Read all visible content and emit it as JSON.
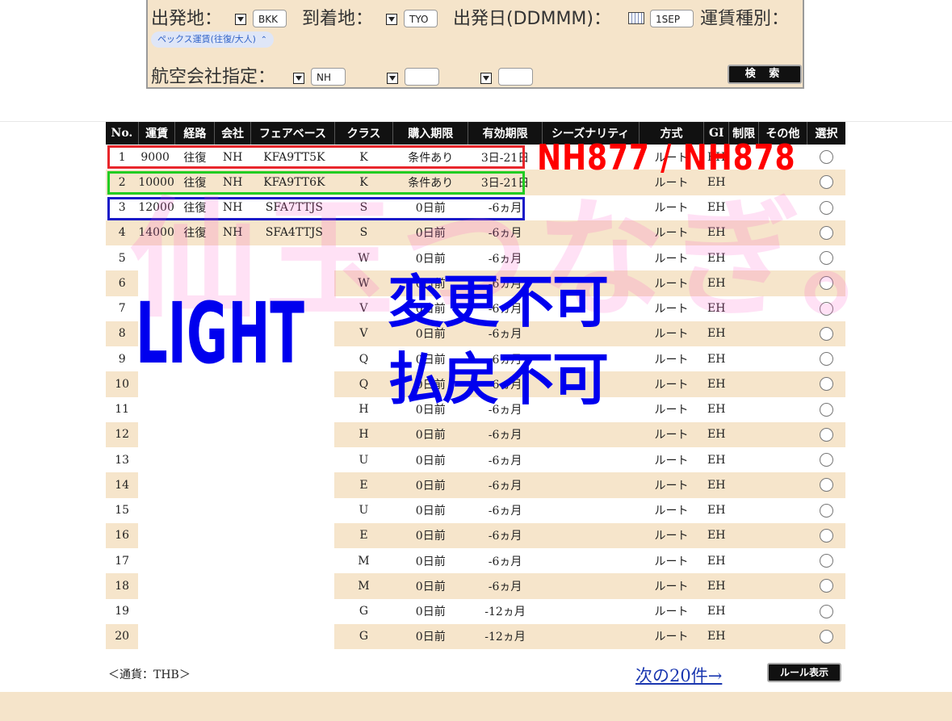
{
  "search_form": {
    "origin_label": "出発地：",
    "origin_value": "BKK",
    "destination_label": "到着地：",
    "destination_value": "TYO",
    "departure_label": "出発日(DDMMM)：",
    "departure_value": "1SEP",
    "fare_type_label": "運賃種別：",
    "fare_type_value": "ペックス運賃(往復/大人)",
    "airline_label": "航空会社指定：",
    "airline_values": [
      "NH",
      "",
      ""
    ],
    "search_button": "検 索"
  },
  "table": {
    "headers": [
      "No.",
      "運賃",
      "経路",
      "会社",
      "フェアベース",
      "クラス",
      "購入期限",
      "有効期限",
      "シーズナリティ",
      "方式",
      "GI",
      "制限",
      "その他",
      "選択"
    ],
    "rows": [
      {
        "no": "1",
        "fare": "9000",
        "route": "往復",
        "carrier": "NH",
        "basis": "KFA9TT5K",
        "cls": "K",
        "purchase": "条件あり",
        "validity": "3日-21日",
        "season": "",
        "method": "ルート",
        "gi": "EH"
      },
      {
        "no": "2",
        "fare": "10000",
        "route": "往復",
        "carrier": "NH",
        "basis": "KFA9TT6K",
        "cls": "K",
        "purchase": "条件あり",
        "validity": "3日-21日",
        "season": "",
        "method": "ルート",
        "gi": "EH"
      },
      {
        "no": "3",
        "fare": "12000",
        "route": "往復",
        "carrier": "NH",
        "basis": "SFA7TTJS",
        "cls": "S",
        "purchase": "0日前",
        "validity": "-6ヵ月",
        "season": "",
        "method": "ルート",
        "gi": "EH"
      },
      {
        "no": "4",
        "fare": "14000",
        "route": "往復",
        "carrier": "NH",
        "basis": "SFA4TTJS",
        "cls": "S",
        "purchase": "0日前",
        "validity": "-6ヵ月",
        "season": "",
        "method": "ルート",
        "gi": "EH"
      },
      {
        "no": "5",
        "fare": "",
        "route": "",
        "carrier": "",
        "basis": "",
        "cls": "W",
        "purchase": "0日前",
        "validity": "-6ヵ月",
        "season": "",
        "method": "ルート",
        "gi": "EH"
      },
      {
        "no": "6",
        "fare": "",
        "route": "",
        "carrier": "",
        "basis": "",
        "cls": "W",
        "purchase": "0日前",
        "validity": "-6ヵ月",
        "season": "",
        "method": "ルート",
        "gi": "EH"
      },
      {
        "no": "7",
        "fare": "",
        "route": "",
        "carrier": "",
        "basis": "",
        "cls": "V",
        "purchase": "0日前",
        "validity": "-6ヵ月",
        "season": "",
        "method": "ルート",
        "gi": "EH"
      },
      {
        "no": "8",
        "fare": "",
        "route": "",
        "carrier": "",
        "basis": "",
        "cls": "V",
        "purchase": "0日前",
        "validity": "-6ヵ月",
        "season": "",
        "method": "ルート",
        "gi": "EH"
      },
      {
        "no": "9",
        "fare": "",
        "route": "",
        "carrier": "",
        "basis": "",
        "cls": "Q",
        "purchase": "0日前",
        "validity": "-6ヵ月",
        "season": "",
        "method": "ルート",
        "gi": "EH"
      },
      {
        "no": "10",
        "fare": "",
        "route": "",
        "carrier": "",
        "basis": "",
        "cls": "Q",
        "purchase": "0日前",
        "validity": "-6ヵ月",
        "season": "",
        "method": "ルート",
        "gi": "EH"
      },
      {
        "no": "11",
        "fare": "",
        "route": "",
        "carrier": "",
        "basis": "",
        "cls": "H",
        "purchase": "0日前",
        "validity": "-6ヵ月",
        "season": "",
        "method": "ルート",
        "gi": "EH"
      },
      {
        "no": "12",
        "fare": "",
        "route": "",
        "carrier": "",
        "basis": "",
        "cls": "H",
        "purchase": "0日前",
        "validity": "-6ヵ月",
        "season": "",
        "method": "ルート",
        "gi": "EH"
      },
      {
        "no": "13",
        "fare": "",
        "route": "",
        "carrier": "",
        "basis": "",
        "cls": "U",
        "purchase": "0日前",
        "validity": "-6ヵ月",
        "season": "",
        "method": "ルート",
        "gi": "EH"
      },
      {
        "no": "14",
        "fare": "",
        "route": "",
        "carrier": "",
        "basis": "",
        "cls": "E",
        "purchase": "0日前",
        "validity": "-6ヵ月",
        "season": "",
        "method": "ルート",
        "gi": "EH"
      },
      {
        "no": "15",
        "fare": "",
        "route": "",
        "carrier": "",
        "basis": "",
        "cls": "U",
        "purchase": "0日前",
        "validity": "-6ヵ月",
        "season": "",
        "method": "ルート",
        "gi": "EH"
      },
      {
        "no": "16",
        "fare": "",
        "route": "",
        "carrier": "",
        "basis": "",
        "cls": "E",
        "purchase": "0日前",
        "validity": "-6ヵ月",
        "season": "",
        "method": "ルート",
        "gi": "EH"
      },
      {
        "no": "17",
        "fare": "",
        "route": "",
        "carrier": "",
        "basis": "",
        "cls": "M",
        "purchase": "0日前",
        "validity": "-6ヵ月",
        "season": "",
        "method": "ルート",
        "gi": "EH"
      },
      {
        "no": "18",
        "fare": "",
        "route": "",
        "carrier": "",
        "basis": "",
        "cls": "M",
        "purchase": "0日前",
        "validity": "-6ヵ月",
        "season": "",
        "method": "ルート",
        "gi": "EH"
      },
      {
        "no": "19",
        "fare": "",
        "route": "",
        "carrier": "",
        "basis": "",
        "cls": "G",
        "purchase": "0日前",
        "validity": "-12ヵ月",
        "season": "",
        "method": "ルート",
        "gi": "EH"
      },
      {
        "no": "20",
        "fare": "",
        "route": "",
        "carrier": "",
        "basis": "",
        "cls": "G",
        "purchase": "0日前",
        "validity": "-12ヵ月",
        "season": "",
        "method": "ルート",
        "gi": "EH"
      }
    ]
  },
  "annotations": {
    "flights": "NH877 / NH878",
    "brand": "LIGHT",
    "no_change": "変更不可",
    "no_refund": "払戻不可",
    "watermark": "仙玉つなぎ。",
    "highlight_colors": [
      "#e8262b",
      "#22cc22",
      "#1a1ac8"
    ]
  },
  "footer": {
    "currency": "＜通貨：THB＞",
    "next_link": "次の20件→",
    "rules_button": "ルール表示"
  }
}
